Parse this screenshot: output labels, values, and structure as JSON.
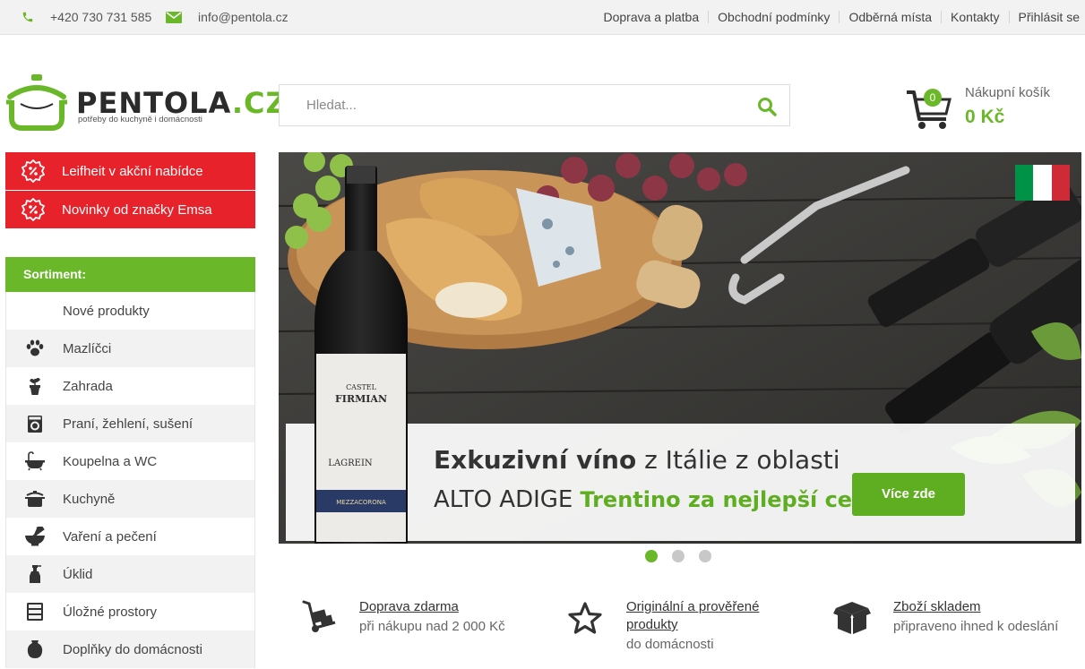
{
  "topbar": {
    "phone": "+420 730 731 585",
    "email": "info@pentola.cz",
    "links": [
      "Doprava a platba",
      "Obchodní podmínky",
      "Odběrná místa",
      "Kontakty",
      "Přihlásit se"
    ]
  },
  "header": {
    "logo_name": "PENTOLA",
    "logo_tld": ".CZ",
    "logo_tagline": "potřeby do kuchyně i domácnosti",
    "search_placeholder": "Hledat...",
    "cart": {
      "count": "0",
      "label": "Nákupní košík",
      "price": "0 Kč"
    }
  },
  "sidebar": {
    "promos": [
      "Leifheit v akční nabídce",
      "Novinky od značky Emsa"
    ],
    "heading": "Sortiment:",
    "items": [
      {
        "label": "Nové produkty",
        "icon": "none"
      },
      {
        "label": "Mazlíčci",
        "icon": "paw-icon"
      },
      {
        "label": "Zahrada",
        "icon": "plant-pot-icon"
      },
      {
        "label": "Praní, žehlení, sušení",
        "icon": "washing-machine-icon"
      },
      {
        "label": "Koupelna a WC",
        "icon": "bathtub-icon"
      },
      {
        "label": "Kuchyně",
        "icon": "pot-icon"
      },
      {
        "label": "Vaření a pečení",
        "icon": "mortar-icon"
      },
      {
        "label": "Úklid",
        "icon": "spray-bottle-icon"
      },
      {
        "label": "Úložné prostory",
        "icon": "drawers-icon"
      },
      {
        "label": "Doplňky do domácnosti",
        "icon": "vase-icon"
      }
    ]
  },
  "banner": {
    "title_bold": "Exkuzivní víno",
    "title_rest": " z Itálie z oblasti",
    "line2": "ALTO ADIGE",
    "line2_green": "Trentino za nejlepší ceny",
    "button": "Více zde",
    "bottle_label_1": "CASTEL",
    "bottle_label_2": "FIRMIAN",
    "bottle_label_3": "LAGREIN",
    "bottle_label_4": "MEZZACORONA",
    "flag_colors": [
      "#009246",
      "#ffffff",
      "#ce2b37"
    ],
    "slides": 3,
    "active_slide": 1
  },
  "benefits": [
    {
      "title": "Doprava zdarma",
      "sub": "při nákupu nad 2 000 Kč",
      "icon": "hand-truck-icon"
    },
    {
      "title": "Originální a prověřené produkty",
      "sub": "do domácnosti",
      "icon": "star-icon"
    },
    {
      "title": "Zboží skladem",
      "sub": "připraveno ihned k odeslání",
      "icon": "box-icon"
    }
  ],
  "colors": {
    "accent_green": "#6ab82a",
    "promo_red": "#e8222a"
  }
}
